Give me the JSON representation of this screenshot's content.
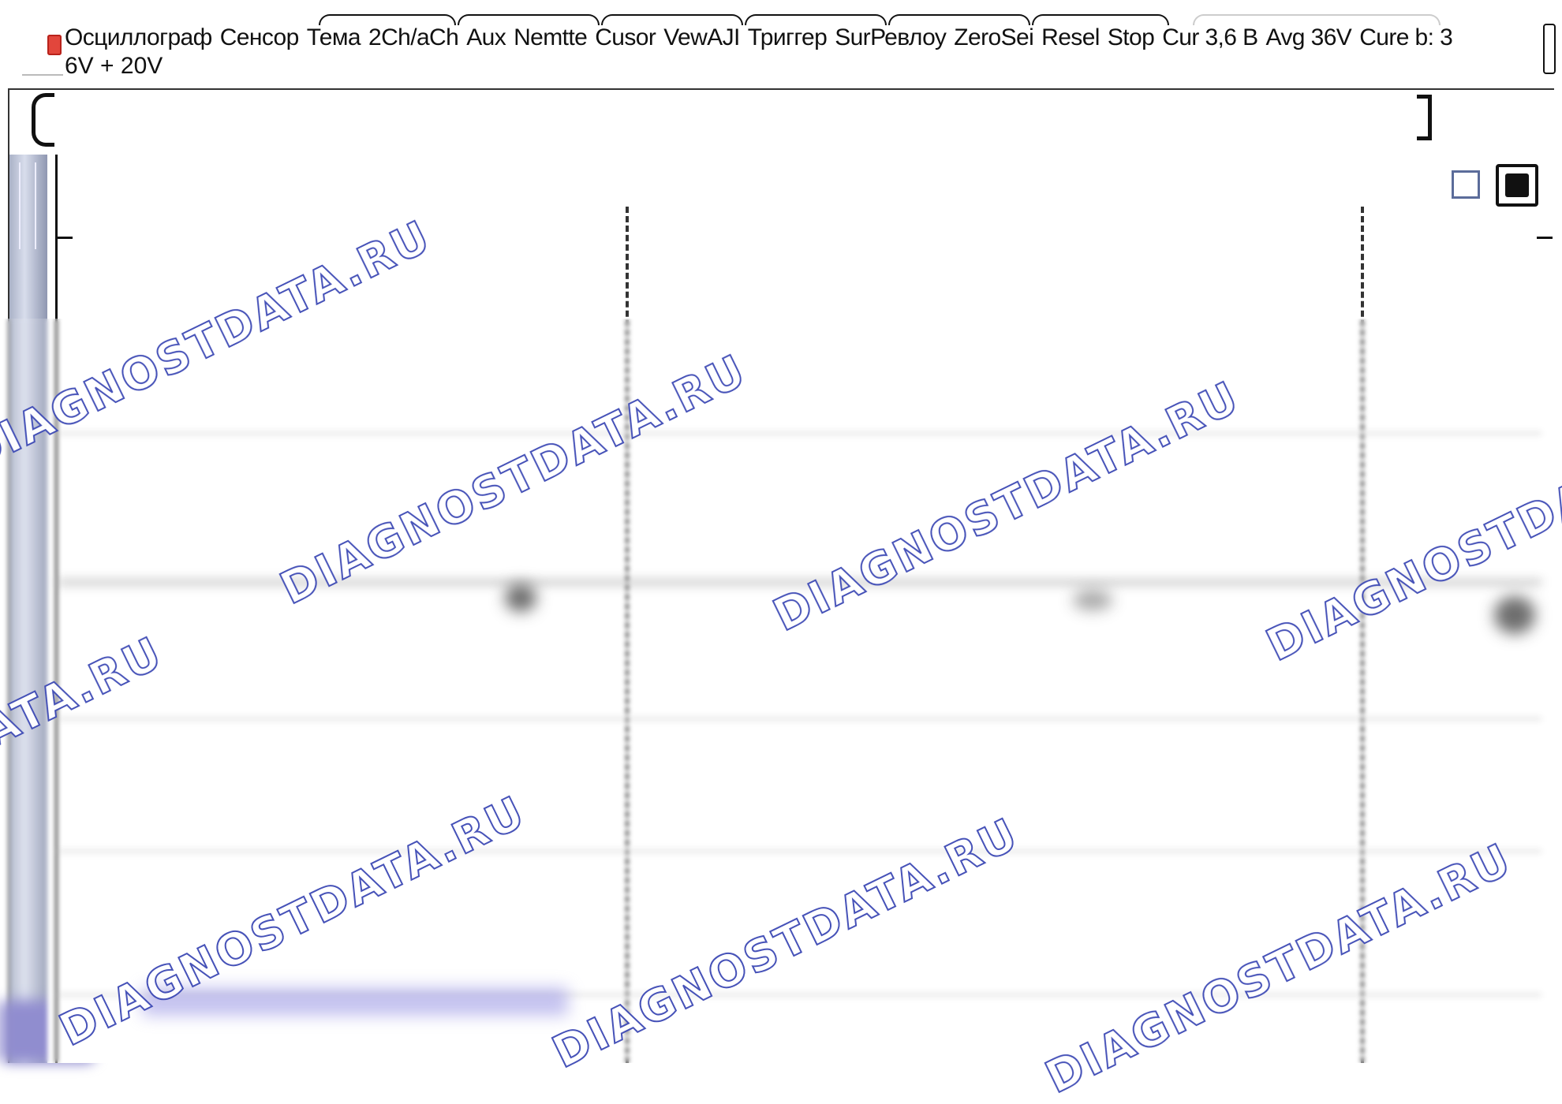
{
  "menu": {
    "items": [
      "Осциллограф",
      "Сенсор",
      "Тема",
      "2Ch/aCh",
      "Aux",
      "Nemtte",
      "Cusor",
      "VewAJI",
      "Триггер",
      "SurРевлоу",
      "ZeroSei",
      "Resel",
      "Stop",
      "Cur 3,6 В",
      "Avg 36V",
      "Cure b: 3"
    ],
    "second_line": "6V + 20V"
  },
  "watermark": {
    "text": "DIAGNOSTDATA.RU",
    "color": "#3d49b5"
  },
  "colors": {
    "app_icon": "#e2463c",
    "side_panel": "#a9b1c6",
    "button_outline": "#5b6c9a"
  }
}
